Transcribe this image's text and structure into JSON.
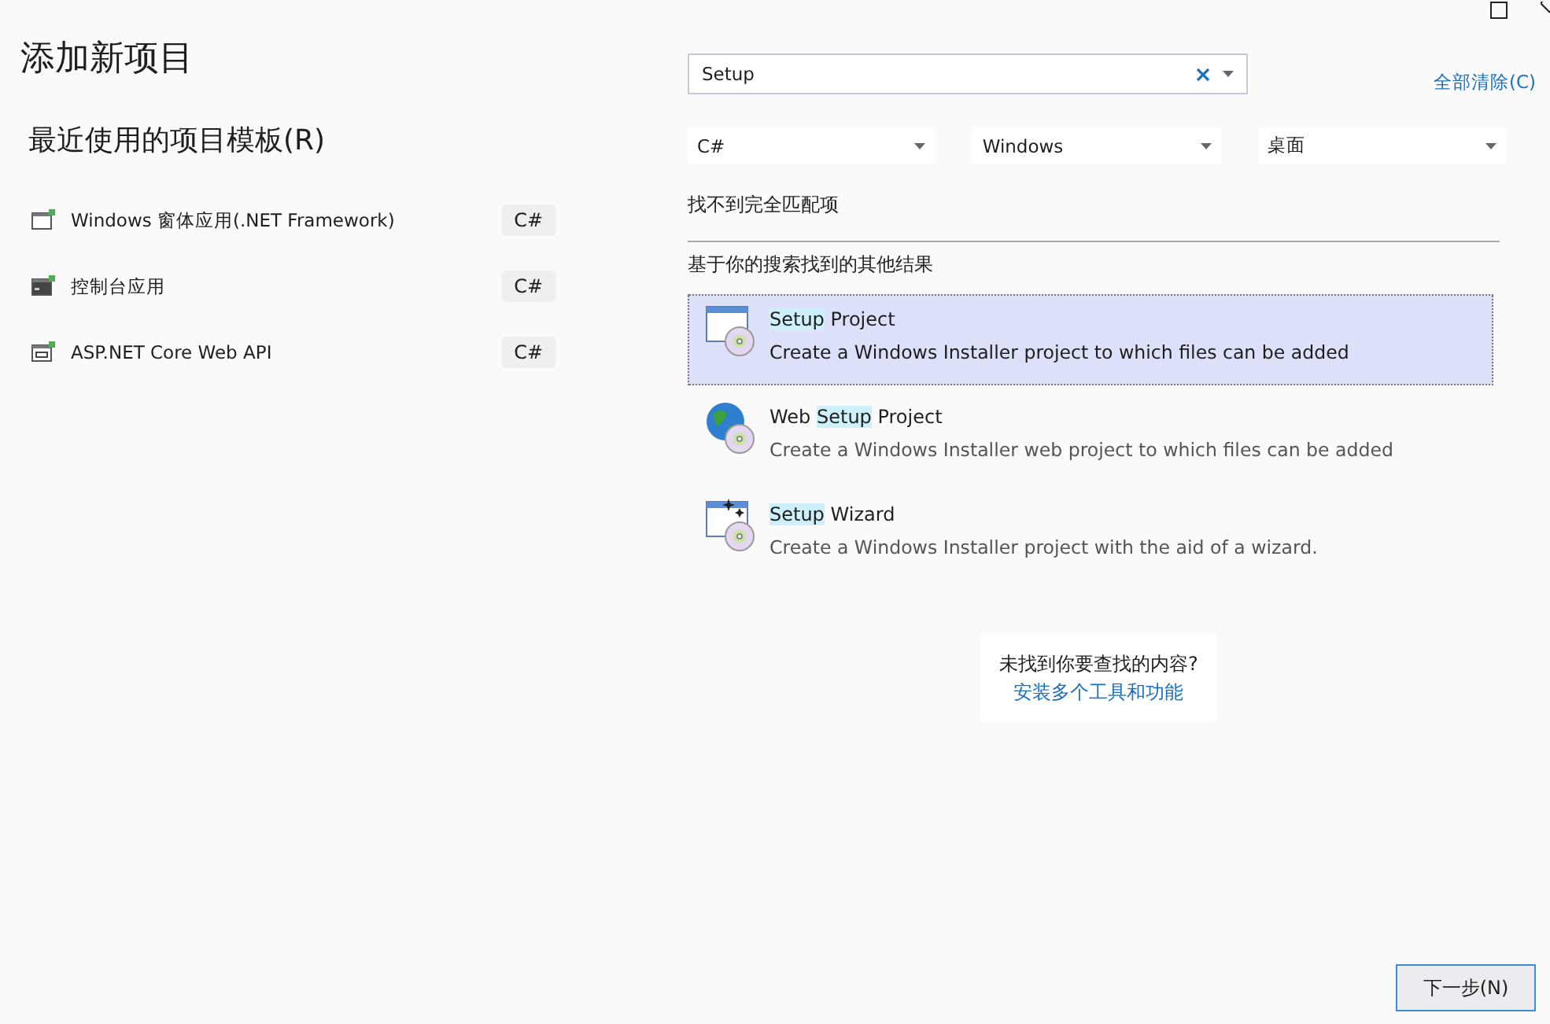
{
  "window": {
    "title": "添加新项目"
  },
  "recent": {
    "heading": "最近使用的项目模板(R)",
    "items": [
      {
        "kind": "form",
        "name": "Windows 窗体应用(.NET Framework)",
        "language": "C#"
      },
      {
        "kind": "console",
        "name": "控制台应用",
        "language": "C#"
      },
      {
        "kind": "api",
        "name": "ASP.NET Core Web API",
        "language": "C#"
      }
    ]
  },
  "search": {
    "value": "Setup"
  },
  "clear_all": "全部清除(C)",
  "filters": [
    "C#",
    "Windows",
    "桌面"
  ],
  "no_exact_match": "找不到完全匹配项",
  "other_results_heading": "基于你的搜索找到的其他结果",
  "results": [
    {
      "kind": "setup",
      "selected": true,
      "title": [
        {
          "text": "Setup",
          "match": true
        },
        {
          "text": " Project",
          "match": false
        }
      ],
      "description": "Create a Windows Installer project to which files can be added"
    },
    {
      "kind": "web",
      "selected": false,
      "title": [
        {
          "text": "Web ",
          "match": false
        },
        {
          "text": "Setup",
          "match": true
        },
        {
          "text": " Project",
          "match": false
        }
      ],
      "description": "Create a Windows Installer web project to which files can be added"
    },
    {
      "kind": "wizard",
      "selected": false,
      "title": [
        {
          "text": "Setup",
          "match": true
        },
        {
          "text": " Wizard",
          "match": false
        }
      ],
      "description": "Create a Windows Installer project with the aid of a wizard."
    }
  ],
  "not_found": {
    "question": "未找到你要查找的内容?",
    "link": "安装多个工具和功能"
  },
  "next_button": "下一步(N)"
}
